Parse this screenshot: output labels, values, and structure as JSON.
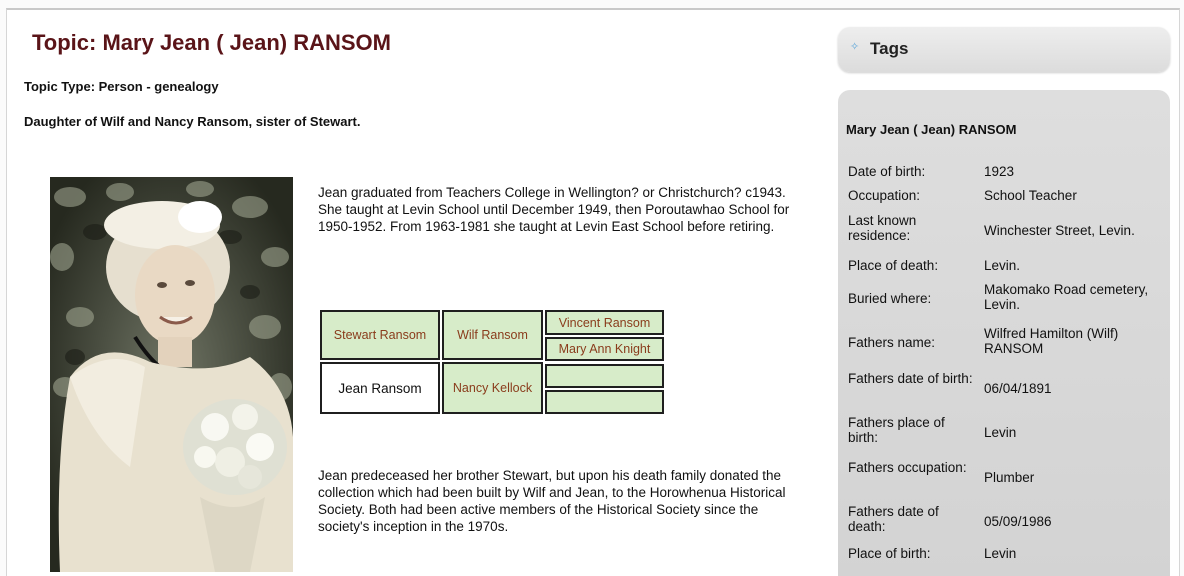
{
  "topic": {
    "title": "Topic: Mary Jean ( Jean) RANSOM",
    "type": "Topic Type: Person - genealogy",
    "description": "Daughter of Wilf and Nancy Ransom, sister of Stewart."
  },
  "body": {
    "paragraph1": "Jean graduated from Teachers College in Wellington? or Christchurch? c1943. She taught at Levin School until December 1949, then Poroutawhao School for 1950-1952. From 1963-1981 she taught at Levin East School before retiring.",
    "paragraph2": "Jean predeceased her brother Stewart, but upon his death family donated the collection which had been built by Wilf and Jean, to the Horowhenua Historical Society. Both had been active members of the Historical Society since the society's inception in the 1970s."
  },
  "family_tree": {
    "sibling": "Stewart Ransom",
    "self": "Jean Ransom",
    "father": "Wilf Ransom",
    "mother": "Nancy Kellock",
    "paternal_grandfather": "Vincent Ransom",
    "paternal_grandmother": "Mary Ann Knight",
    "maternal_grandfather": "",
    "maternal_grandmother": ""
  },
  "sidebar": {
    "tags_label": "Tags",
    "panel_title": "Mary Jean ( Jean) RANSOM",
    "rows": [
      {
        "label": "Date of birth:",
        "value": "1923"
      },
      {
        "label": "Occupation:",
        "value": "School Teacher"
      },
      {
        "label": "Last known residence:",
        "value": "Winchester Street, Levin."
      },
      {
        "label": "Place of death:",
        "value": "Levin."
      },
      {
        "label": "Buried where:",
        "value": "Makomako Road cemetery, Levin."
      },
      {
        "label": "Fathers name:",
        "value": "Wilfred Hamilton (Wilf) RANSOM"
      },
      {
        "label": "Fathers date of birth:",
        "value": "06/04/1891"
      },
      {
        "label": "Fathers place of birth:",
        "value": "Levin"
      },
      {
        "label": "Fathers occupation:",
        "value": "Plumber"
      },
      {
        "label": "Fathers date of death:",
        "value": "05/09/1986"
      },
      {
        "label": "Place of birth:",
        "value": "Levin"
      }
    ]
  },
  "colors": {
    "title": "#5a1418",
    "tree_fill": "#d7ecc9",
    "tree_text": "#8a3c1c",
    "panel_bg": "#d8d8d8"
  }
}
